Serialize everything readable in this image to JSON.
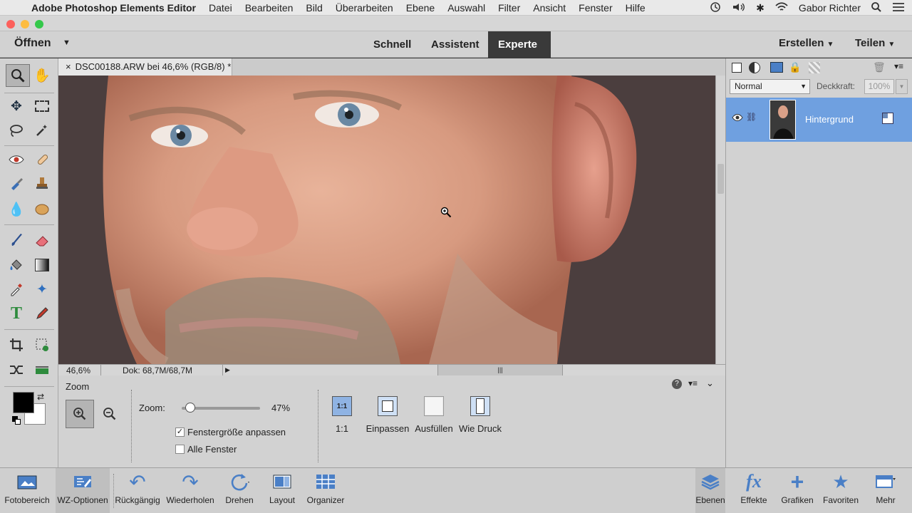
{
  "menubar": {
    "app_name": "Adobe Photoshop Elements Editor",
    "menus": [
      "Datei",
      "Bearbeiten",
      "Bild",
      "Überarbeiten",
      "Ebene",
      "Auswahl",
      "Filter",
      "Ansicht",
      "Fenster",
      "Hilfe"
    ],
    "user": "Gabor Richter"
  },
  "modebar": {
    "open": "Öffnen",
    "modes": [
      "Schnell",
      "Assistent",
      "Experte"
    ],
    "create": "Erstellen",
    "share": "Teilen"
  },
  "document": {
    "tab_title": "DSC00188.ARW bei 46,6% (RGB/8) *",
    "zoom_status": "46,6%",
    "doc_size": "Dok: 68,7M/68,7M"
  },
  "options": {
    "title": "Zoom",
    "zoom_label": "Zoom:",
    "zoom_value": "47%",
    "zoom_fraction": 0.06,
    "fit_window": "Fenstergröße anpassen",
    "fit_window_checked": true,
    "all_windows": "Alle Fenster",
    "all_windows_checked": false,
    "view_buttons": [
      "1:1",
      "Einpassen",
      "Ausfüllen",
      "Wie Druck"
    ],
    "one_to_one_icon_text": "1:1"
  },
  "layers": {
    "blend_mode": "Normal",
    "opacity_label": "Deckkraft:",
    "opacity_value": "100%",
    "layer_name": "Hintergrund"
  },
  "taskbar": {
    "left": [
      "Fotobereich",
      "WZ-Optionen",
      "Rückgängig",
      "Wiederholen",
      "Drehen",
      "Layout",
      "Organizer"
    ],
    "right": [
      "Ebenen",
      "Effekte",
      "Grafiken",
      "Favoriten",
      "Mehr"
    ]
  },
  "colors": {
    "accent": "#6fa0e0",
    "expert_tab": "#3a3a3a",
    "panel": "#d2d2d2"
  }
}
